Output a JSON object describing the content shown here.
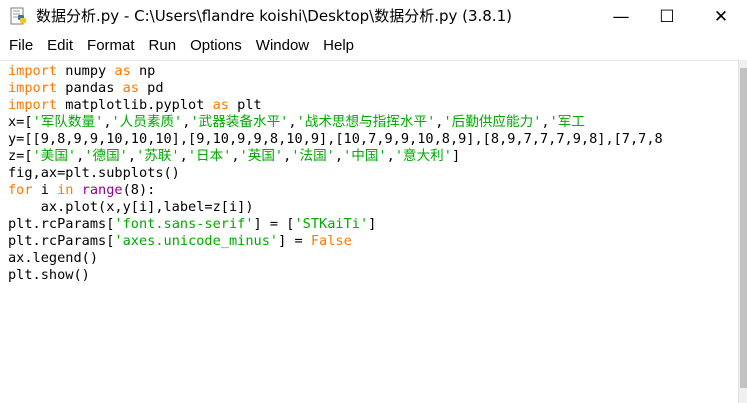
{
  "window": {
    "title": "数据分析.py - C:\\Users\\flandre koishi\\Desktop\\数据分析.py (3.8.1)",
    "app_icon": "python-idle-icon",
    "controls": {
      "minimize": "—",
      "maximize": "☐",
      "close": "✕"
    }
  },
  "menu": [
    "File",
    "Edit",
    "Format",
    "Run",
    "Options",
    "Window",
    "Help"
  ],
  "colors": {
    "keyword": "#ff7700",
    "string": "#00aa00",
    "builtin": "#900090",
    "text": "#000000"
  },
  "code": [
    [
      {
        "t": "import",
        "c": "kw"
      },
      {
        "t": " numpy "
      },
      {
        "t": "as",
        "c": "kw"
      },
      {
        "t": " np"
      }
    ],
    [
      {
        "t": "import",
        "c": "kw"
      },
      {
        "t": " pandas "
      },
      {
        "t": "as",
        "c": "kw"
      },
      {
        "t": " pd"
      }
    ],
    [
      {
        "t": "import",
        "c": "kw"
      },
      {
        "t": " matplotlib.pyplot "
      },
      {
        "t": "as",
        "c": "kw"
      },
      {
        "t": " plt"
      }
    ],
    [
      {
        "t": "x=["
      },
      {
        "t": "'军队数量'",
        "c": "str"
      },
      {
        "t": ","
      },
      {
        "t": "'人员素质'",
        "c": "str"
      },
      {
        "t": ","
      },
      {
        "t": "'武器装备水平'",
        "c": "str"
      },
      {
        "t": ","
      },
      {
        "t": "'战术思想与指挥水平'",
        "c": "str"
      },
      {
        "t": ","
      },
      {
        "t": "'后勤供应能力'",
        "c": "str"
      },
      {
        "t": ","
      },
      {
        "t": "'军工",
        "c": "str"
      }
    ],
    [
      {
        "t": "y=[[9,8,9,9,10,10,10],[9,10,9,9,8,10,9],[10,7,9,9,10,8,9],[8,9,7,7,7,9,8],[7,7,8"
      }
    ],
    [
      {
        "t": "z=["
      },
      {
        "t": "'美国'",
        "c": "str"
      },
      {
        "t": ","
      },
      {
        "t": "'德国'",
        "c": "str"
      },
      {
        "t": ","
      },
      {
        "t": "'苏联'",
        "c": "str"
      },
      {
        "t": ","
      },
      {
        "t": "'日本'",
        "c": "str"
      },
      {
        "t": ","
      },
      {
        "t": "'英国'",
        "c": "str"
      },
      {
        "t": ","
      },
      {
        "t": "'法国'",
        "c": "str"
      },
      {
        "t": ","
      },
      {
        "t": "'中国'",
        "c": "str"
      },
      {
        "t": ","
      },
      {
        "t": "'意大利'",
        "c": "str"
      },
      {
        "t": "]"
      }
    ],
    [
      {
        "t": "fig,ax=plt.subplots()"
      }
    ],
    [
      {
        "t": "for",
        "c": "kw"
      },
      {
        "t": " i "
      },
      {
        "t": "in",
        "c": "kw"
      },
      {
        "t": " "
      },
      {
        "t": "range",
        "c": "bi"
      },
      {
        "t": "(8):"
      }
    ],
    [
      {
        "t": "    ax.plot(x,y[i],label=z[i])"
      }
    ],
    [
      {
        "t": "plt.rcParams["
      },
      {
        "t": "'font.sans-serif'",
        "c": "str"
      },
      {
        "t": "] = ["
      },
      {
        "t": "'STKaiTi'",
        "c": "str"
      },
      {
        "t": "]"
      }
    ],
    [
      {
        "t": "plt.rcParams["
      },
      {
        "t": "'axes.unicode_minus'",
        "c": "str"
      },
      {
        "t": "] = "
      },
      {
        "t": "False",
        "c": "kw"
      }
    ],
    [
      {
        "t": "ax.legend()"
      }
    ],
    [
      {
        "t": "plt.show()"
      }
    ]
  ]
}
